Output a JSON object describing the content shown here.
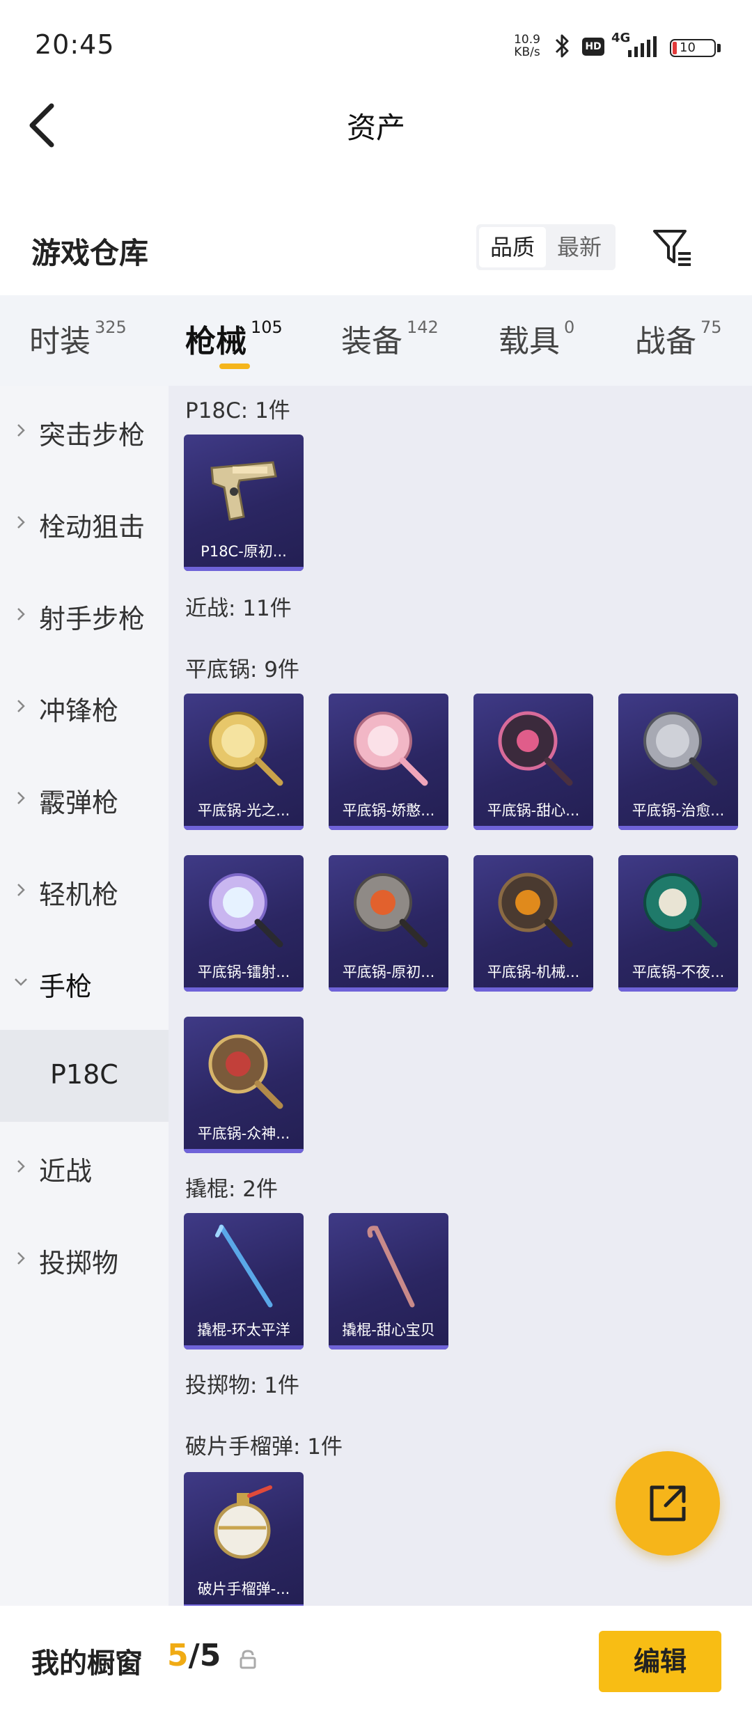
{
  "status_bar": {
    "time": "20:45",
    "net_speed_value": "10.9",
    "net_speed_unit": "KB/s",
    "hd": "HD",
    "network": "4G",
    "battery": "10"
  },
  "header": {
    "title": "资产",
    "back_icon": "chevron-left-icon"
  },
  "warehouse": {
    "title": "游戏仓库",
    "sort": {
      "quality": "品质",
      "newest": "最新",
      "selected": "品质"
    },
    "filter_icon": "filter-icon"
  },
  "tabs": [
    {
      "label": "时装",
      "count": "325"
    },
    {
      "label": "枪械",
      "count": "105",
      "active": true
    },
    {
      "label": "装备",
      "count": "142"
    },
    {
      "label": "载具",
      "count": "0"
    },
    {
      "label": "战备",
      "count": "75"
    }
  ],
  "sidebar": {
    "items": [
      {
        "label": "突击步枪"
      },
      {
        "label": "栓动狙击"
      },
      {
        "label": "射手步枪"
      },
      {
        "label": "冲锋枪"
      },
      {
        "label": "霰弹枪"
      },
      {
        "label": "轻机枪"
      },
      {
        "label": "手枪",
        "expanded": true
      },
      {
        "label": "近战"
      },
      {
        "label": "投掷物"
      }
    ],
    "sub_selected": "P18C"
  },
  "content": {
    "sections": [
      {
        "title": "P18C: 1件"
      },
      {
        "title": "近战: 11件"
      },
      {
        "title": "平底锅: 9件"
      },
      {
        "title": "撬棍: 2件"
      },
      {
        "title": "投掷物: 1件"
      },
      {
        "title": "破片手榴弹: 1件"
      }
    ],
    "items": [
      {
        "name": "P18C-原初...",
        "icon": "pistol-icon"
      },
      {
        "name": "平底锅-光之...",
        "icon": "frying-pan-gold-icon"
      },
      {
        "name": "平底锅-娇憨...",
        "icon": "frying-pan-pink-icon"
      },
      {
        "name": "平底锅-甜心...",
        "icon": "frying-pan-dark-pink-icon"
      },
      {
        "name": "平底锅-治愈...",
        "icon": "frying-pan-silver-icon"
      },
      {
        "name": "平底锅-镭射...",
        "icon": "frying-pan-laser-icon"
      },
      {
        "name": "平底锅-原初...",
        "icon": "frying-pan-orange-icon"
      },
      {
        "name": "平底锅-机械...",
        "icon": "frying-pan-mech-icon"
      },
      {
        "name": "平底锅-不夜...",
        "icon": "frying-pan-green-icon"
      },
      {
        "name": "平底锅-众神...",
        "icon": "frying-pan-gods-icon"
      },
      {
        "name": "撬棍-环太平洋",
        "icon": "crowbar-blue-icon"
      },
      {
        "name": "撬棍-甜心宝贝",
        "icon": "crowbar-pink-icon"
      },
      {
        "name": "破片手榴弹-...",
        "icon": "grenade-icon"
      }
    ]
  },
  "fab": {
    "icon": "share-external-icon"
  },
  "bottom_bar": {
    "label": "我的橱窗",
    "current": "5",
    "separator": "/",
    "total": "5",
    "lock_icon": "lock-icon",
    "edit": "编辑"
  },
  "colors": {
    "accent": "#f6b51a",
    "card_bg": "#2b2662",
    "content_bg": "#ebecf3",
    "battery_low": "#e23b3b"
  }
}
